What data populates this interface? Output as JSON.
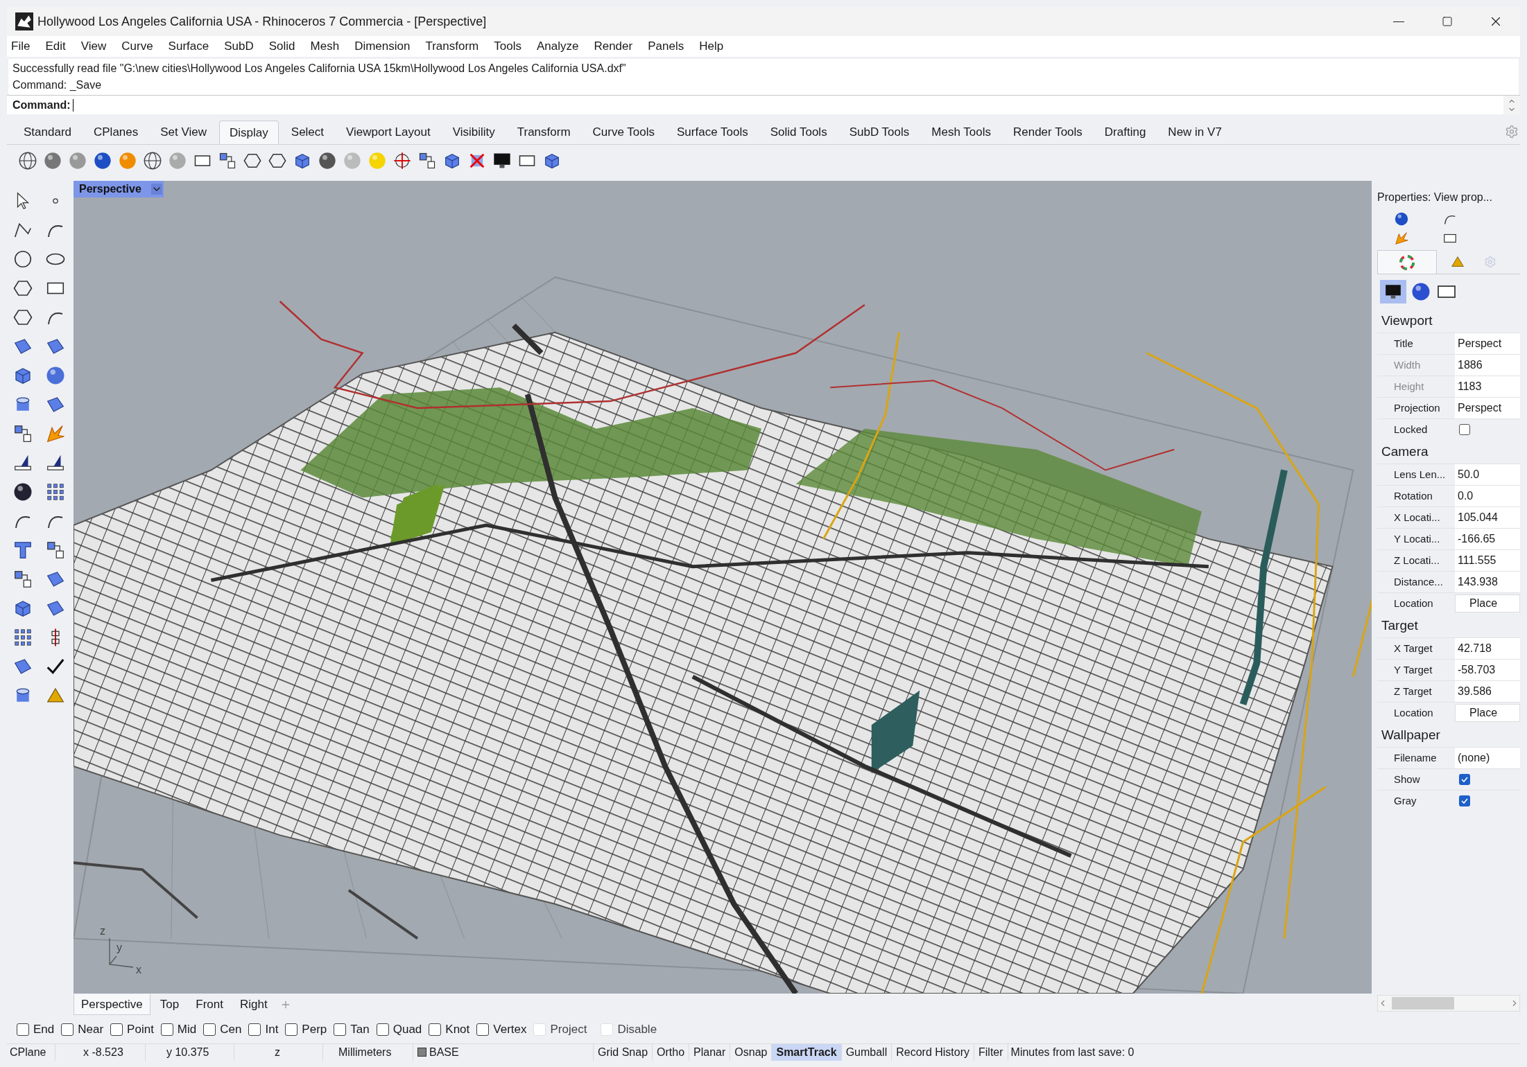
{
  "window": {
    "title": "Hollywood Los Angeles California USA - Rhinoceros 7 Commercia - [Perspective]"
  },
  "menu": [
    "File",
    "Edit",
    "View",
    "Curve",
    "Surface",
    "SubD",
    "Solid",
    "Mesh",
    "Dimension",
    "Transform",
    "Tools",
    "Analyze",
    "Render",
    "Panels",
    "Help"
  ],
  "command": {
    "history": [
      "Successfully read file \"G:\\new cities\\Hollywood Los Angeles California USA 15km\\Hollywood Los Angeles California USA.dxf\"",
      "Command: _Save"
    ],
    "prompt": "Command:"
  },
  "toolbar_tabs": [
    {
      "label": "Standard",
      "selected": false
    },
    {
      "label": "CPlanes",
      "selected": false
    },
    {
      "label": "Set View",
      "selected": false
    },
    {
      "label": "Display",
      "selected": true
    },
    {
      "label": "Select",
      "selected": false
    },
    {
      "label": "Viewport Layout",
      "selected": false
    },
    {
      "label": "Visibility",
      "selected": false
    },
    {
      "label": "Transform",
      "selected": false
    },
    {
      "label": "Curve Tools",
      "selected": false
    },
    {
      "label": "Surface Tools",
      "selected": false
    },
    {
      "label": "Solid Tools",
      "selected": false
    },
    {
      "label": "SubD Tools",
      "selected": false
    },
    {
      "label": "Mesh Tools",
      "selected": false
    },
    {
      "label": "Render Tools",
      "selected": false
    },
    {
      "label": "Drafting",
      "selected": false
    },
    {
      "label": "New in V7",
      "selected": false
    }
  ],
  "viewport": {
    "title": "Perspective",
    "axes": [
      "z",
      "y",
      "x"
    ]
  },
  "viewport_tabs": [
    {
      "label": "Perspective",
      "selected": true
    },
    {
      "label": "Top",
      "selected": false
    },
    {
      "label": "Front",
      "selected": false
    },
    {
      "label": "Right",
      "selected": false
    }
  ],
  "properties": {
    "title": "Properties: View prop...",
    "sections": [
      {
        "heading": "Viewport",
        "rows": [
          {
            "kind": "text",
            "label": "Title",
            "value": "Perspect",
            "disabled": false
          },
          {
            "kind": "text",
            "label": "Width",
            "value": "1886",
            "disabled": true
          },
          {
            "kind": "text",
            "label": "Height",
            "value": "1183",
            "disabled": true
          },
          {
            "kind": "text",
            "label": "Projection",
            "value": "Perspect",
            "disabled": false
          },
          {
            "kind": "checkbox",
            "label": "Locked",
            "checked": false,
            "disabled": false
          }
        ]
      },
      {
        "heading": "Camera",
        "rows": [
          {
            "kind": "text",
            "label": "Lens Len...",
            "value": "50.0",
            "disabled": false
          },
          {
            "kind": "text",
            "label": "Rotation",
            "value": "0.0",
            "disabled": false
          },
          {
            "kind": "text",
            "label": "X Locati...",
            "value": "105.044",
            "disabled": false
          },
          {
            "kind": "text",
            "label": "Y Locati...",
            "value": "-166.65",
            "disabled": false
          },
          {
            "kind": "text",
            "label": "Z Locati...",
            "value": "111.555",
            "disabled": false
          },
          {
            "kind": "text",
            "label": "Distance...",
            "value": "143.938",
            "disabled": false
          },
          {
            "kind": "button",
            "label": "Location",
            "value": "Place",
            "disabled": false
          }
        ]
      },
      {
        "heading": "Target",
        "rows": [
          {
            "kind": "text",
            "label": "X Target",
            "value": "42.718",
            "disabled": false
          },
          {
            "kind": "text",
            "label": "Y Target",
            "value": "-58.703",
            "disabled": false
          },
          {
            "kind": "text",
            "label": "Z Target",
            "value": "39.586",
            "disabled": false
          },
          {
            "kind": "button",
            "label": "Location",
            "value": "Place",
            "disabled": false
          }
        ]
      },
      {
        "heading": "Wallpaper",
        "rows": [
          {
            "kind": "text",
            "label": "Filename",
            "value": "(none)",
            "disabled": false
          },
          {
            "kind": "checkbox",
            "label": "Show",
            "checked": true,
            "disabled": false
          },
          {
            "kind": "checkbox",
            "label": "Gray",
            "checked": true,
            "disabled": false
          }
        ]
      }
    ]
  },
  "osnaps": [
    {
      "label": "End",
      "checked": false,
      "disabled": false
    },
    {
      "label": "Near",
      "checked": false,
      "disabled": false
    },
    {
      "label": "Point",
      "checked": false,
      "disabled": false
    },
    {
      "label": "Mid",
      "checked": false,
      "disabled": false
    },
    {
      "label": "Cen",
      "checked": false,
      "disabled": false
    },
    {
      "label": "Int",
      "checked": false,
      "disabled": false
    },
    {
      "label": "Perp",
      "checked": false,
      "disabled": false
    },
    {
      "label": "Tan",
      "checked": false,
      "disabled": false
    },
    {
      "label": "Quad",
      "checked": false,
      "disabled": false
    },
    {
      "label": "Knot",
      "checked": false,
      "disabled": false
    },
    {
      "label": "Vertex",
      "checked": false,
      "disabled": false
    },
    {
      "label": "Project",
      "checked": false,
      "disabled": true
    },
    {
      "label": "Disable",
      "checked": false,
      "disabled": true
    }
  ],
  "status_bar": {
    "cplane": "CPlane",
    "x": "x -8.523",
    "y": "y 10.375",
    "z": "z",
    "units": "Millimeters",
    "layer": {
      "name": "BASE",
      "color": "#808080"
    },
    "toggles": [
      {
        "label": "Grid Snap",
        "on": false
      },
      {
        "label": "Ortho",
        "on": false
      },
      {
        "label": "Planar",
        "on": false
      },
      {
        "label": "Osnap",
        "on": false
      },
      {
        "label": "SmartTrack",
        "on": true
      },
      {
        "label": "Gumball",
        "on": false
      },
      {
        "label": "Record History",
        "on": false
      },
      {
        "label": "Filter",
        "on": false
      }
    ],
    "message": "Minutes from last save: 0"
  }
}
